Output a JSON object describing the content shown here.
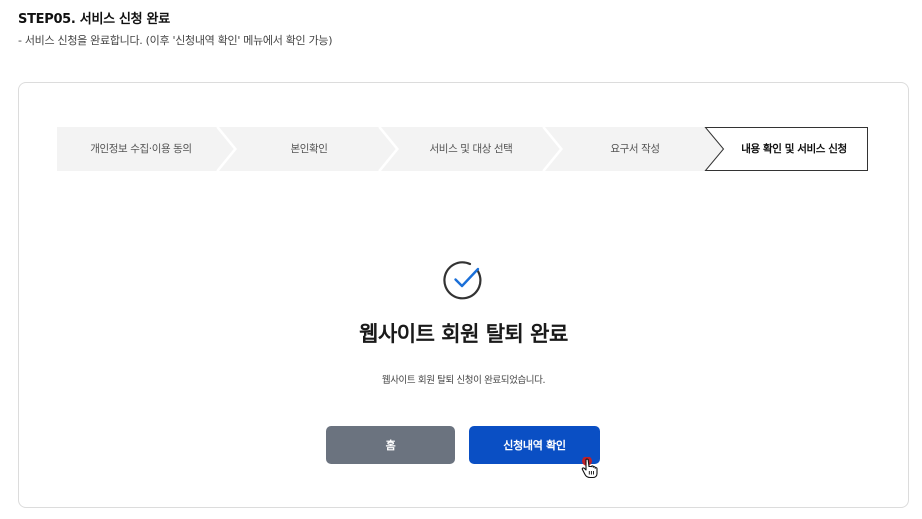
{
  "header": {
    "step_title": "STEP05. 서비스 신청 완료",
    "step_desc": "- 서비스 신청을 완료합니다. (이후 '신청내역 확인' 메뉴에서 확인 가능)"
  },
  "stepper": {
    "steps": [
      {
        "label": "개인정보 수집·이용 동의",
        "active": false
      },
      {
        "label": "본인확인",
        "active": false
      },
      {
        "label": "서비스 및 대상 선택",
        "active": false
      },
      {
        "label": "요구서 작성",
        "active": false
      },
      {
        "label": "내용 확인 및 서비스 신청",
        "active": true
      }
    ]
  },
  "result": {
    "icon": "check-circle-icon",
    "title": "웹사이트 회원 탈퇴 완료",
    "description": "웹사이트 회원 탈퇴 신청이 완료되었습니다."
  },
  "buttons": {
    "home_label": "홈",
    "check_label": "신청내역 확인"
  },
  "colors": {
    "primary": "#0a4fc4",
    "secondary": "#6b737f",
    "step_bg": "#f3f3f3",
    "accent_blue": "#1a6fd8"
  }
}
